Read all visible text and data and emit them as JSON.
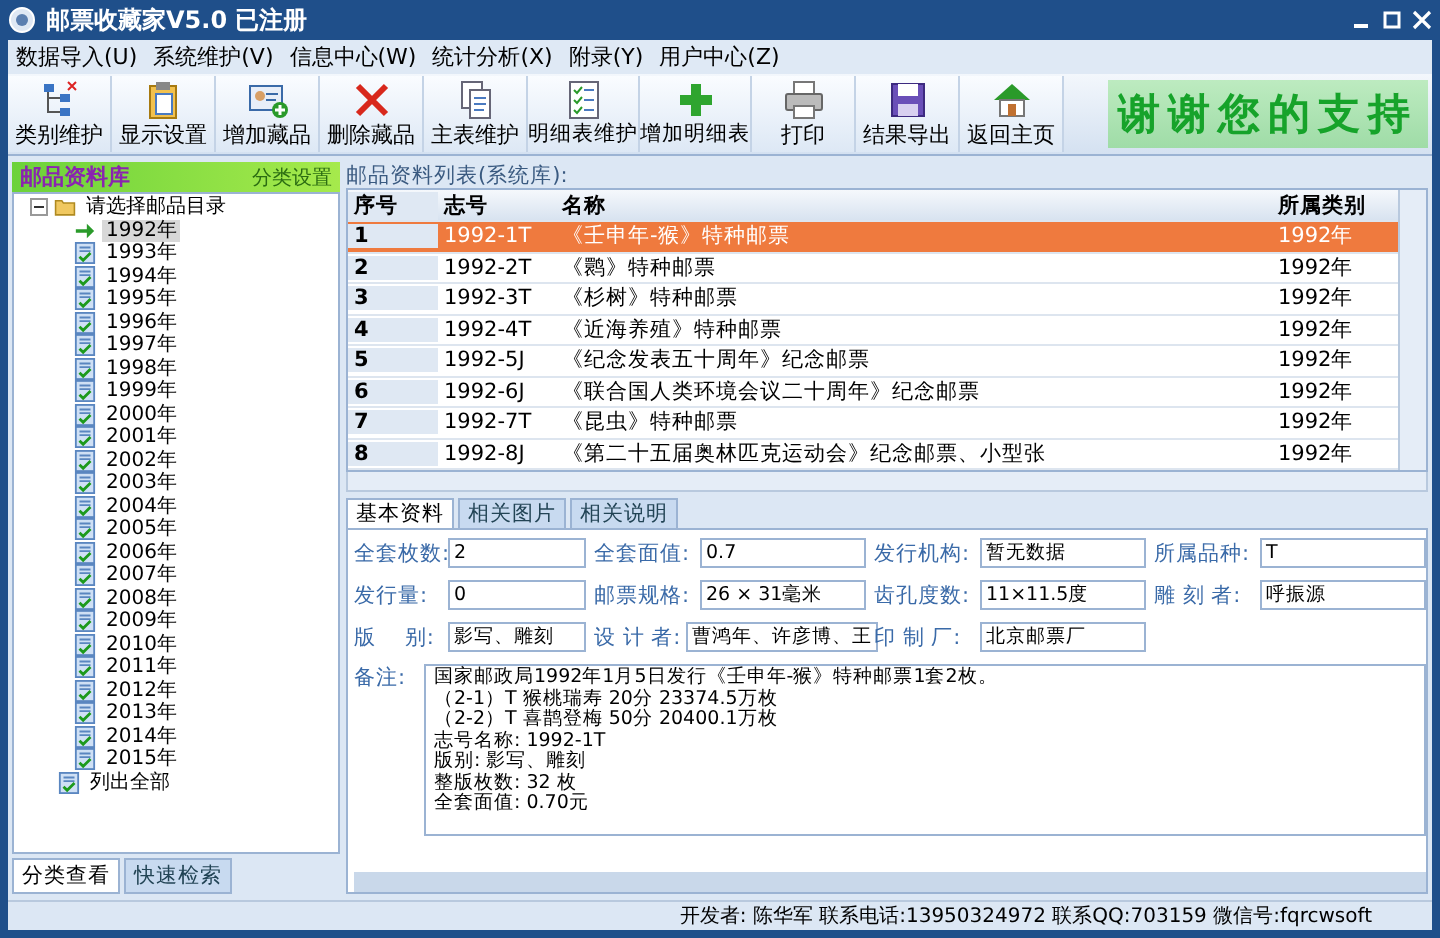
{
  "window": {
    "title": "邮票收藏家V5.0 已注册"
  },
  "menu": [
    "数据导入(U)",
    "系统维护(V)",
    "信息中心(W)",
    "统计分析(X)",
    "附录(Y)",
    "用户中心(Z)"
  ],
  "toolbar": [
    "类别维护",
    "显示设置",
    "增加藏品",
    "删除藏品",
    "主表维护",
    "明细表维护",
    "增加明细表",
    "打印",
    "结果导出",
    "返回主页"
  ],
  "banner": "谢谢您的支持",
  "sidebar": {
    "title": "邮品资料库",
    "settings": "分类设置",
    "tree": [
      {
        "label": "请选择邮品目录",
        "expanded": true,
        "children": [
          {
            "label": "1992年",
            "selected": true
          },
          {
            "label": "1993年",
            "selected": false
          },
          {
            "label": "1994年",
            "selected": false
          },
          {
            "label": "1995年",
            "selected": false
          },
          {
            "label": "1996年",
            "selected": false
          },
          {
            "label": "1997年",
            "selected": false
          },
          {
            "label": "1998年",
            "selected": false
          },
          {
            "label": "1999年",
            "selected": false
          },
          {
            "label": "2000年",
            "selected": false
          },
          {
            "label": "2001年",
            "selected": false
          },
          {
            "label": "2002年",
            "selected": false
          },
          {
            "label": "2003年",
            "selected": false
          },
          {
            "label": "2004年",
            "selected": false
          },
          {
            "label": "2005年",
            "selected": false
          },
          {
            "label": "2006年",
            "selected": false
          },
          {
            "label": "2007年",
            "selected": false
          },
          {
            "label": "2008年",
            "selected": false
          },
          {
            "label": "2009年",
            "selected": false
          },
          {
            "label": "2010年",
            "selected": false
          },
          {
            "label": "2011年",
            "selected": false
          },
          {
            "label": "2012年",
            "selected": false
          },
          {
            "label": "2013年",
            "selected": false
          },
          {
            "label": "2014年",
            "selected": false
          },
          {
            "label": "2015年",
            "selected": false
          }
        ]
      },
      {
        "label": "列出全部",
        "selected": false
      }
    ],
    "tabs": [
      {
        "label": "分类查看",
        "selected": true
      },
      {
        "label": "快速检索",
        "selected": false
      }
    ]
  },
  "table": {
    "caption": "邮品资料列表(系统库):",
    "columns": [
      "序号",
      "志号",
      "名称",
      "所属类别"
    ],
    "rows": [
      {
        "cells": [
          "1",
          "1992-1T",
          "《壬申年-猴》特种邮票",
          "1992年"
        ],
        "selected": true
      },
      {
        "cells": [
          "2",
          "1992-2T",
          "《鹮》特种邮票",
          "1992年"
        ],
        "selected": false
      },
      {
        "cells": [
          "3",
          "1992-3T",
          "《杉树》特种邮票",
          "1992年"
        ],
        "selected": false
      },
      {
        "cells": [
          "4",
          "1992-4T",
          "《近海养殖》特种邮票",
          "1992年"
        ],
        "selected": false
      },
      {
        "cells": [
          "5",
          "1992-5J",
          "《纪念发表五十周年》纪念邮票",
          "1992年"
        ],
        "selected": false
      },
      {
        "cells": [
          "6",
          "1992-6J",
          "《联合国人类环境会议二十周年》纪念邮票",
          "1992年"
        ],
        "selected": false
      },
      {
        "cells": [
          "7",
          "1992-7T",
          "《昆虫》特种邮票",
          "1992年"
        ],
        "selected": false
      },
      {
        "cells": [
          "8",
          "1992-8J",
          "《第二十五届奥林匹克运动会》纪念邮票、小型张",
          "1992年"
        ],
        "selected": false
      }
    ]
  },
  "detail_tabs": [
    {
      "label": "基本资料",
      "selected": true
    },
    {
      "label": "相关图片",
      "selected": false
    },
    {
      "label": "相关说明",
      "selected": false
    }
  ],
  "fields": [
    [
      {
        "label": "全套枚数:",
        "value": "2"
      },
      {
        "label": "全套面值:",
        "value": "0.7"
      },
      {
        "label": "发行机构:",
        "value": "暂无数据"
      },
      {
        "label": "所属品种:",
        "value": "T"
      }
    ],
    [
      {
        "label": "发行量:",
        "value": "0"
      },
      {
        "label": "邮票规格:",
        "value": "26 × 31毫米"
      },
      {
        "label": "齿孔度数:",
        "value": "11×11.5度"
      },
      {
        "label": "雕 刻 者:",
        "value": "呼振源"
      }
    ],
    [
      {
        "label": "版　 别:",
        "value": "影写、雕刻"
      },
      {
        "label": "设 计 者:",
        "value": "曹鸿年、许彦博、王"
      },
      {
        "label": "印 制 厂:",
        "value": "北京邮票厂"
      }
    ]
  ],
  "notes": {
    "label": "备注:",
    "lines": [
      "国家邮政局1992年1月5日发行《壬申年-猴》特种邮票1套2枚。",
      "（2-1）T 猴桃瑞寿 20分 23374.5万枚",
      "（2-2）T 喜鹊登梅 50分 20400.1万枚",
      "志号名称: 1992-1T",
      "版别: 影写、雕刻",
      "整版枚数: 32 枚",
      "全套面值: 0.70元"
    ]
  },
  "status_bar": "开发者: 陈华军 联系电话:13950324972 联系QQ:703159 微信号:fqrcwsoft"
}
